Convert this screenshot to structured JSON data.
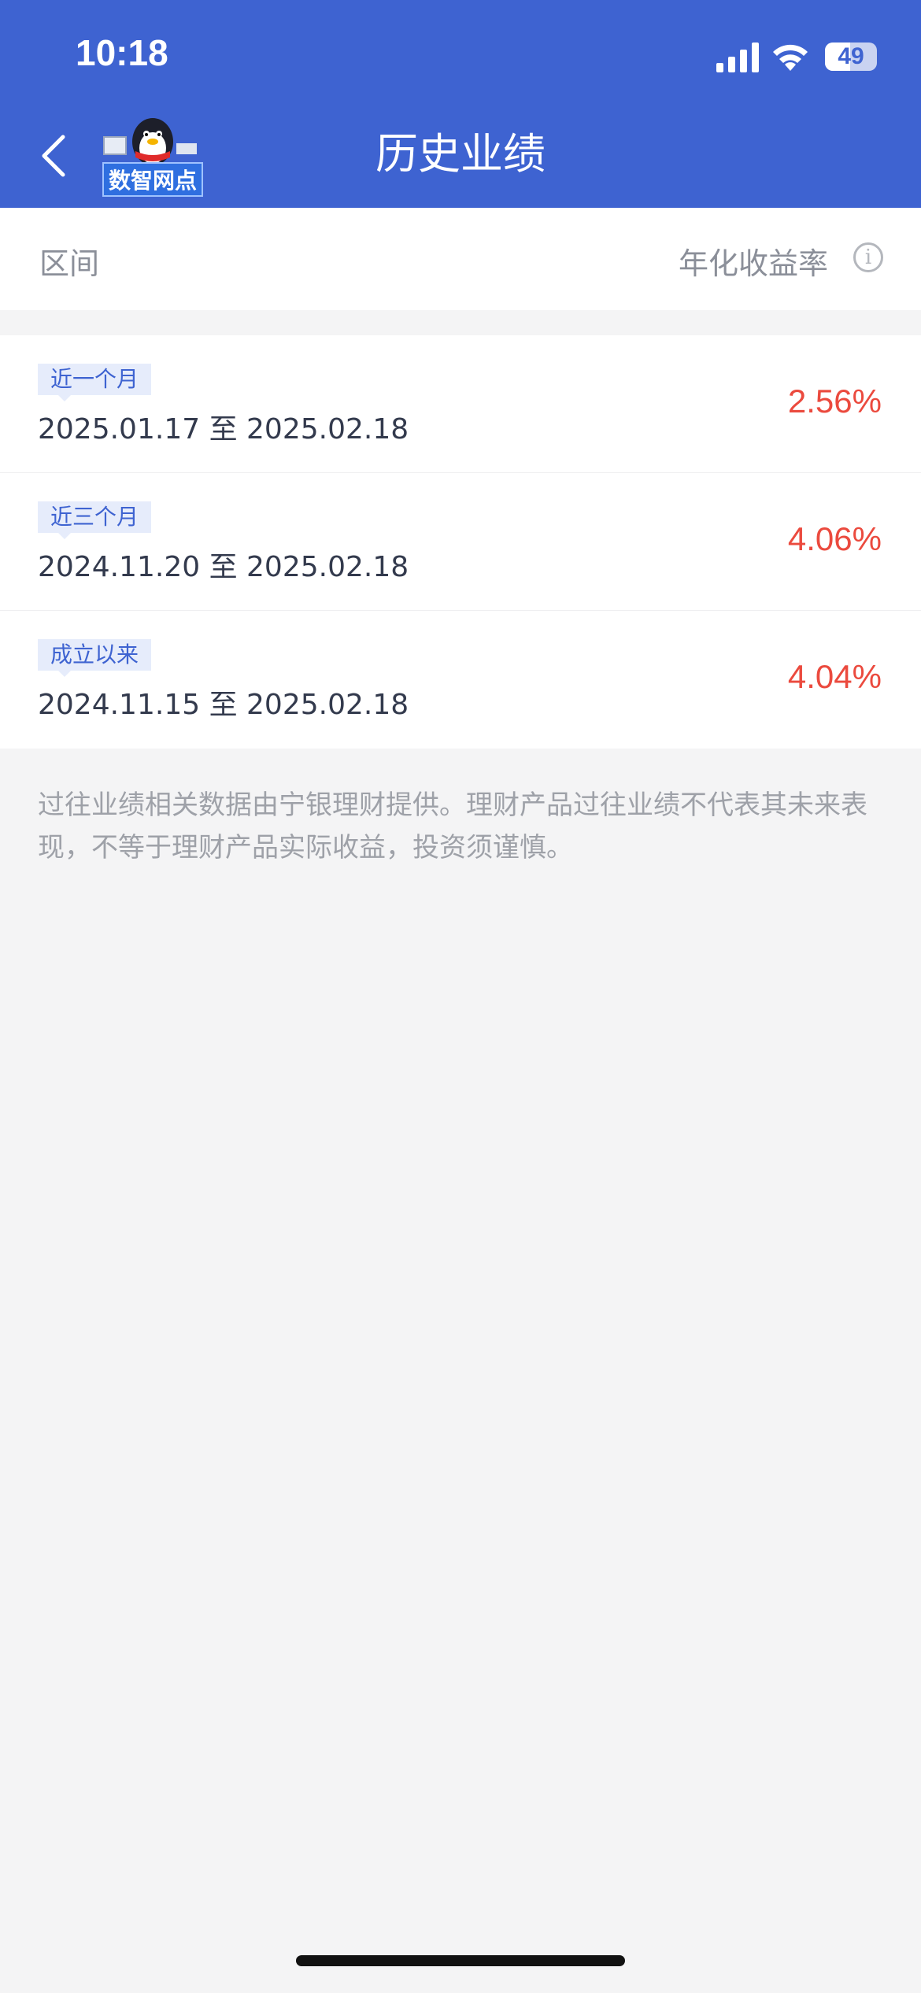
{
  "status_bar": {
    "time": "10:18",
    "battery": "49"
  },
  "nav": {
    "title": "历史业绩",
    "logo_text": "数智网点"
  },
  "columns": {
    "left": "区间",
    "right": "年化收益率"
  },
  "rows": [
    {
      "tag": "近一个月",
      "dates": "2025.01.17 至 2025.02.18",
      "rate": "2.56%"
    },
    {
      "tag": "近三个月",
      "dates": "2024.11.20 至 2025.02.18",
      "rate": "4.06%"
    },
    {
      "tag": "成立以来",
      "dates": "2024.11.15 至 2025.02.18",
      "rate": "4.04%"
    }
  ],
  "disclaimer": "过往业绩相关数据由宁银理财提供。理财产品过往业绩不代表其未来表现，不等于理财产品实际收益，投资须谨慎。",
  "colors": {
    "header_bg": "#3e63d1",
    "rate": "#eb4a3e",
    "tag_bg": "#e6ecfb"
  }
}
